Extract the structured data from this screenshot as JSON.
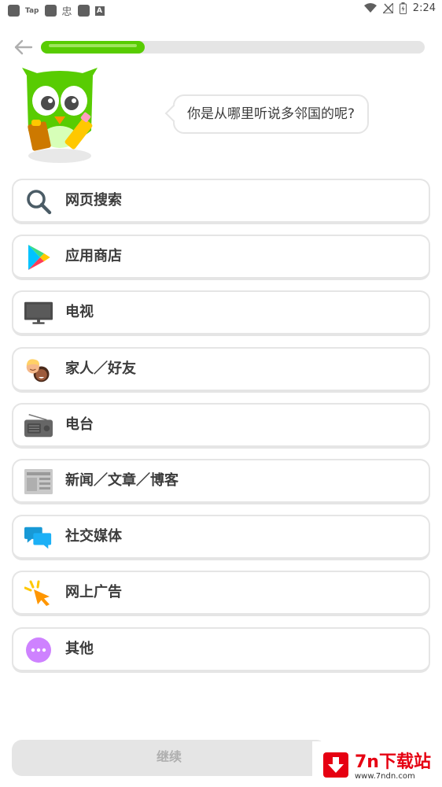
{
  "status_bar": {
    "tap_label": "Tap",
    "glyph": "忠",
    "a_label": "A",
    "time": "2:24"
  },
  "progress": {
    "fraction": 0.27
  },
  "question": {
    "text": "你是从哪里听说多邻国的呢?"
  },
  "options": [
    {
      "label": "网页搜索",
      "icon": "magnifier-icon"
    },
    {
      "label": "应用商店",
      "icon": "play-store-icon"
    },
    {
      "label": "电视",
      "icon": "tv-icon"
    },
    {
      "label": "家人／好友",
      "icon": "people-icon"
    },
    {
      "label": "电台",
      "icon": "radio-icon"
    },
    {
      "label": "新闻／文章／博客",
      "icon": "newspaper-icon"
    },
    {
      "label": "社交媒体",
      "icon": "chat-bubbles-icon"
    },
    {
      "label": "网上广告",
      "icon": "ad-cursor-icon"
    },
    {
      "label": "其他",
      "icon": "more-icon"
    }
  ],
  "continue_label": "继续",
  "watermark": {
    "title": "7n下载站",
    "url": "www.7ndn.com"
  },
  "colors": {
    "green": "#58cc02",
    "border": "#e5e5e5",
    "text": "#3c3c3c",
    "watermark_red": "#e60012"
  }
}
